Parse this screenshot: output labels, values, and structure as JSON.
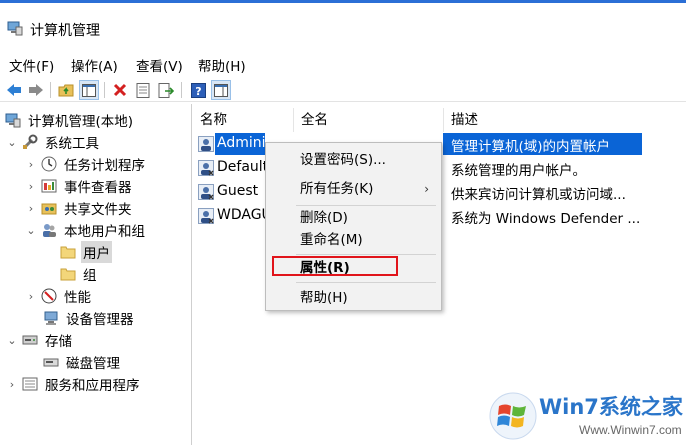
{
  "window": {
    "title": "计算机管理"
  },
  "menu": [
    "文件(F)",
    "操作(A)",
    "查看(V)",
    "帮助(H)"
  ],
  "toolbar": [
    "back-icon",
    "forward-icon",
    "up-folder-icon",
    "show-tree-icon",
    "delete-icon",
    "properties-icon",
    "export-icon",
    "help-icon",
    "console-icon"
  ],
  "tree": {
    "root": "计算机管理(本地)",
    "system_tools": "系统工具",
    "task_scheduler": "任务计划程序",
    "event_viewer": "事件查看器",
    "shared_folders": "共享文件夹",
    "local_users": "本地用户和组",
    "users": "用户",
    "groups": "组",
    "performance": "性能",
    "device_manager": "设备管理器",
    "storage": "存储",
    "disk_management": "磁盘管理",
    "services": "服务和应用程序"
  },
  "columns": {
    "name": "名称",
    "fullname": "全名",
    "description": "描述"
  },
  "rows": [
    {
      "name": "Administr",
      "description": "管理计算机(域)的内置帐户"
    },
    {
      "name": "Default",
      "description": "系统管理的用户帐户。"
    },
    {
      "name": "Guest",
      "description": "供来宾访问计算机或访问域..."
    },
    {
      "name": "WDAGU",
      "description": "系统为 Windows Defender ..."
    }
  ],
  "context_menu": {
    "set_password": "设置密码(S)...",
    "all_tasks": "所有任务(K)",
    "delete": "删除(D)",
    "rename": "重命名(M)",
    "properties": "属性(R)",
    "help": "帮助(H)"
  },
  "watermark": {
    "brand": "Win7系统之家",
    "url": "Www.Winwin7.com"
  },
  "colors": {
    "selection": "#0a64d6",
    "highlight_box": "#e1141b",
    "titlebar_accent": "#2b6fd6"
  }
}
